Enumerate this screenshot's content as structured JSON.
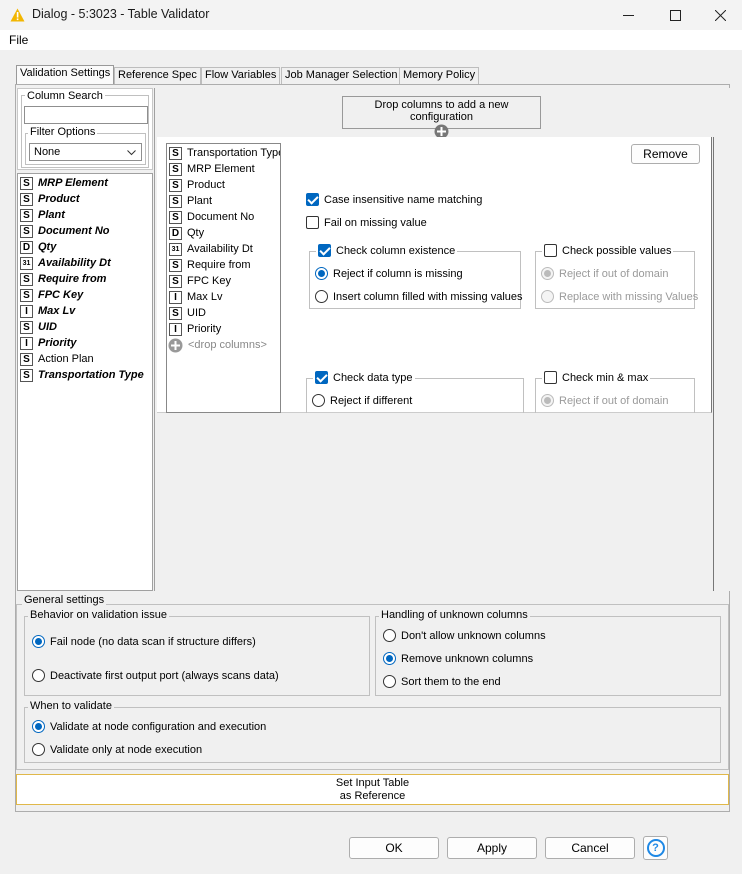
{
  "window": {
    "title": "Dialog - 5:3023 - Table Validator",
    "controls": {
      "minimize": "—",
      "maximize": "☐",
      "close": "✕"
    }
  },
  "menu": [
    "File"
  ],
  "tabs": [
    "Validation Settings",
    "Reference Spec",
    "Flow Variables",
    "Job Manager Selection",
    "Memory Policy"
  ],
  "column_search": {
    "title": "Column Search",
    "value": "",
    "filter_options_title": "Filter Options",
    "filter_selected": "None"
  },
  "left_columns": [
    {
      "type": "S",
      "name": "MRP Element",
      "bold": true
    },
    {
      "type": "S",
      "name": "Product",
      "bold": true
    },
    {
      "type": "S",
      "name": "Plant",
      "bold": true
    },
    {
      "type": "S",
      "name": "Document No",
      "bold": true
    },
    {
      "type": "D",
      "name": "Qty",
      "bold": true
    },
    {
      "type": "31",
      "name": "Availability Dt",
      "bold": true
    },
    {
      "type": "S",
      "name": "Require from",
      "bold": true
    },
    {
      "type": "S",
      "name": "FPC Key",
      "bold": true
    },
    {
      "type": "I",
      "name": "Max Lv",
      "bold": true
    },
    {
      "type": "S",
      "name": "UID",
      "bold": true
    },
    {
      "type": "I",
      "name": "Priority",
      "bold": true
    },
    {
      "type": "S",
      "name": "Action Plan",
      "bold": false
    },
    {
      "type": "S",
      "name": "Transportation Type",
      "bold": true
    }
  ],
  "drop_box": {
    "label": "Drop columns to add a new configuration"
  },
  "config_columns": [
    {
      "type": "S",
      "name": "Transportation Type"
    },
    {
      "type": "S",
      "name": "MRP Element"
    },
    {
      "type": "S",
      "name": "Product"
    },
    {
      "type": "S",
      "name": "Plant"
    },
    {
      "type": "S",
      "name": "Document No"
    },
    {
      "type": "D",
      "name": "Qty"
    },
    {
      "type": "31",
      "name": "Availability Dt"
    },
    {
      "type": "S",
      "name": "Require from"
    },
    {
      "type": "S",
      "name": "FPC Key"
    },
    {
      "type": "I",
      "name": "Max Lv"
    },
    {
      "type": "S",
      "name": "UID"
    },
    {
      "type": "I",
      "name": "Priority"
    }
  ],
  "drop_columns_label": "<drop columns>",
  "config": {
    "remove_label": "Remove",
    "case_insensitive": "Case insensitive name matching",
    "fail_missing": "Fail on missing value",
    "check_existence": "Check column existence",
    "reject_missing": "Reject if column is missing",
    "insert_column": "Insert column filled with missing values",
    "check_possible": "Check possible values",
    "reject_domain": "Reject if out of domain",
    "replace_missing": "Replace with missing Values",
    "check_type": "Check data type",
    "reject_different": "Reject if different",
    "check_minmax": "Check min & max",
    "reject_domain2": "Reject if out of domain"
  },
  "general": {
    "title": "General settings",
    "behavior_title": "Behavior on validation issue",
    "fail_node": "Fail node (no data scan if structure differs)",
    "deactivate": "Deactivate first output port (always scans data)",
    "unknown_title": "Handling of unknown columns",
    "dont_allow": "Don't allow unknown columns",
    "remove_unknown": "Remove unknown columns",
    "sort_end": "Sort them to the end",
    "when_title": "When to validate",
    "validate_config": "Validate at node configuration and execution",
    "validate_exec": "Validate only at node execution"
  },
  "set_ref": {
    "line1": "Set Input Table",
    "line2": "as Reference"
  },
  "footer": {
    "ok": "OK",
    "apply": "Apply",
    "cancel": "Cancel",
    "help": "?"
  },
  "colors": {
    "accent": "#0067c0",
    "warning": "#f2b600"
  }
}
